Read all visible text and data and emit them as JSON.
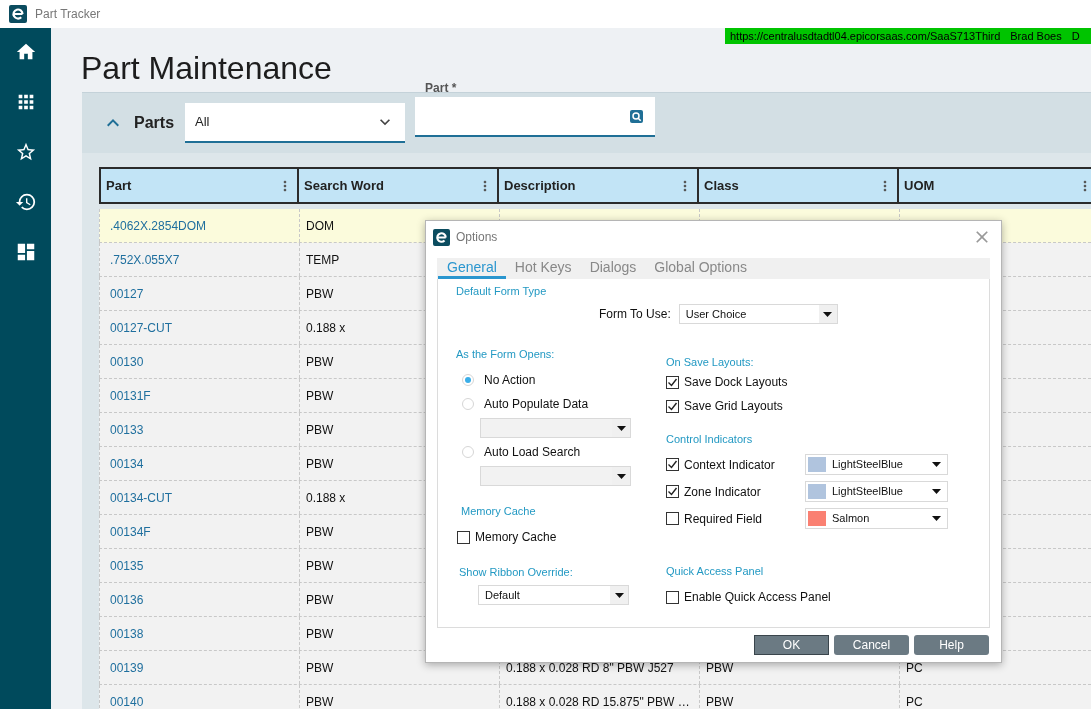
{
  "app_bar": {
    "title": "Part Tracker"
  },
  "session_bar": {
    "url": "https://centralusdtadtl04.epicorsaas.com/SaaS713Third",
    "user": "Brad Boes",
    "extra": "D"
  },
  "page": {
    "title": "Part Maintenance"
  },
  "parts_panel": {
    "title": "Parts",
    "expanded": true,
    "filter": {
      "value": "All"
    },
    "part_field": {
      "label": "Part *"
    }
  },
  "grid": {
    "columns": [
      "Part",
      "Search Word",
      "Description",
      "Class",
      "UOM"
    ],
    "rows": [
      {
        "part": ".4062X.2854DOM",
        "search_word": "DOM",
        "selected": true
      },
      {
        "part": ".752X.055X7",
        "search_word": "TEMP",
        "selected": false
      },
      {
        "part": "00127",
        "search_word": "PBW",
        "selected": false
      },
      {
        "part": "00127-CUT",
        "search_word": "0.188 x",
        "selected": false
      },
      {
        "part": "00130",
        "search_word": "PBW",
        "selected": false
      },
      {
        "part": "00131F",
        "search_word": "PBW",
        "selected": false
      },
      {
        "part": "00133",
        "search_word": "PBW",
        "selected": false
      },
      {
        "part": "00134",
        "search_word": "PBW",
        "selected": false
      },
      {
        "part": "00134-CUT",
        "search_word": "0.188 x",
        "selected": false
      },
      {
        "part": "00134F",
        "search_word": "PBW",
        "selected": false
      },
      {
        "part": "00135",
        "search_word": "PBW",
        "selected": false
      },
      {
        "part": "00136",
        "search_word": "PBW",
        "selected": false
      },
      {
        "part": "00138",
        "search_word": "PBW",
        "selected": false
      },
      {
        "part": "00139",
        "search_word": "PBW",
        "description": "0.188 x 0.028 RD 8\" PBW J527",
        "class": "PBW",
        "uom": "PC",
        "selected": false
      },
      {
        "part": "00140",
        "search_word": "PBW",
        "description": "0.188 x 0.028 RD 15.875\" PBW …",
        "class": "PBW",
        "uom": "PC",
        "selected": false
      }
    ]
  },
  "dialog": {
    "title": "Options",
    "tabs": [
      {
        "label": "General",
        "selected": true
      },
      {
        "label": "Hot Keys",
        "selected": false
      },
      {
        "label": "Dialogs",
        "selected": false
      },
      {
        "label": "Global Options",
        "selected": false
      }
    ],
    "default_form_type": {
      "heading": "Default Form Type",
      "label": "Form To Use:",
      "value": "User Choice"
    },
    "form_opens": {
      "heading": "As the Form Opens:",
      "options": [
        {
          "label": "No Action",
          "selected": true,
          "kind": "plain"
        },
        {
          "label": "Auto Populate Data",
          "selected": false,
          "kind": "with_list"
        },
        {
          "label": "Auto Load Search",
          "selected": false,
          "kind": "with_list"
        }
      ]
    },
    "memory_cache": {
      "heading": "Memory Cache",
      "label": "Memory Cache",
      "checked": false
    },
    "ribbon": {
      "heading": "Show Ribbon Override:",
      "value": "Default"
    },
    "save_layouts": {
      "heading": "On Save Layouts:",
      "items": [
        {
          "label": "Save Dock Layouts",
          "checked": true
        },
        {
          "label": "Save Grid Layouts",
          "checked": true
        }
      ]
    },
    "indicators": {
      "heading": "Control Indicators",
      "items": [
        {
          "label": "Context Indicator",
          "checked": true,
          "color": "#b0c4de",
          "color_name": "LightSteelBlue"
        },
        {
          "label": "Zone Indicator",
          "checked": true,
          "color": "#b0c4de",
          "color_name": "LightSteelBlue"
        },
        {
          "label": "Required Field",
          "checked": false,
          "color": "#fa8072",
          "color_name": "Salmon"
        }
      ]
    },
    "quick_access": {
      "heading": "Quick Access Panel",
      "label": "Enable Quick Access Panel",
      "checked": false
    },
    "buttons": [
      "OK",
      "Cancel",
      "Help"
    ]
  }
}
